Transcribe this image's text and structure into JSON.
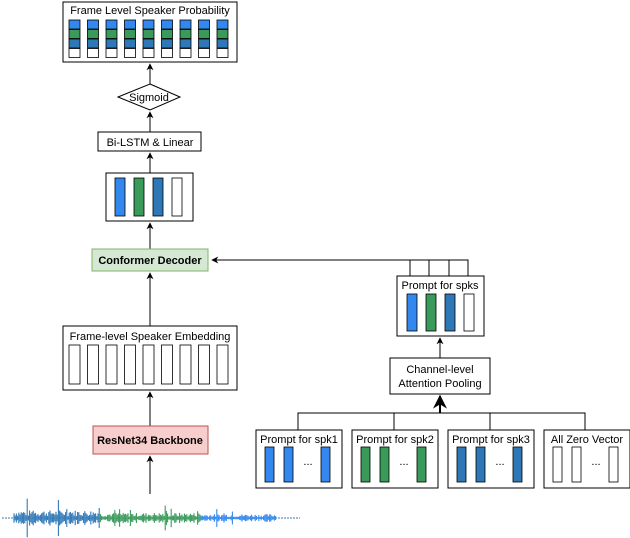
{
  "colors": {
    "spk1_blue": "#3388f0",
    "spk2_green": "#3a9a5a",
    "spk3_darkblue": "#2f78b7",
    "zero_white": "#ffffff",
    "decoder_fill": "#d5e8d4",
    "decoder_stroke": "#82b366",
    "backbone_fill": "#f8cecc",
    "backbone_stroke": "#b85450"
  },
  "nodes": {
    "output": {
      "label": "Frame Level Speaker Probability"
    },
    "sigmoid": {
      "label": "Sigmoid"
    },
    "bilstm": {
      "label": "Bi-LSTM & Linear"
    },
    "decoder": {
      "label": "Conformer Decoder"
    },
    "embedding": {
      "label": "Frame-level Speaker Embedding"
    },
    "backbone": {
      "label": "ResNet34 Backbone"
    },
    "prompt_spks": {
      "label": "Prompt for spks"
    },
    "pooling": {
      "label_line1": "Channel-level",
      "label_line2": "Attention Pooling"
    },
    "prompts": [
      {
        "label": "Prompt for spk1",
        "color_key": "spk1_blue",
        "ellipsis": "..."
      },
      {
        "label": "Prompt for spk2",
        "color_key": "spk2_green",
        "ellipsis": "..."
      },
      {
        "label": "Prompt for spk3",
        "color_key": "spk3_darkblue",
        "ellipsis": "..."
      },
      {
        "label": "All Zero Vector",
        "color_key": "zero_white",
        "ellipsis": "..."
      }
    ]
  },
  "output_frames": 9,
  "embedding_frames": 9,
  "speaker_rows": [
    "spk1_blue",
    "spk2_green",
    "spk3_darkblue",
    "zero_white"
  ]
}
